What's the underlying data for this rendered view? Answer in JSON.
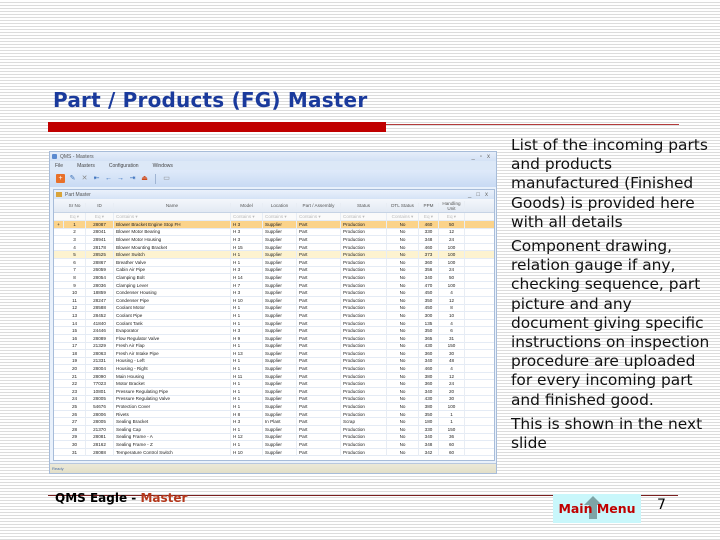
{
  "slide": {
    "title": "Part / Products (FG) Master",
    "bullets": [
      "List of the incoming parts and products manufactured (Finished Goods) is provided here with all details",
      "Component drawing, relation gauge if any, checking sequence, part picture and any document giving specific instructions on inspection procedure are uploaded for every incoming part and finished good.",
      "This is shown in the next slide"
    ],
    "footer": {
      "brand_prefix": "QMS Eagle - ",
      "brand_accent": "Master",
      "main_menu_label": "Main Menu",
      "page_number": "7"
    }
  },
  "app": {
    "title": "QMS - Masters",
    "window_controls": [
      "_",
      "▫",
      "x"
    ],
    "menu": [
      "File",
      "Masters",
      "Configuration",
      "Windows"
    ],
    "toolbar": [
      {
        "name": "add",
        "glyph": "+",
        "color": "#e8702a"
      },
      {
        "name": "edit",
        "glyph": "✎",
        "color": "#3a6fb5"
      },
      {
        "name": "delete",
        "glyph": "✕",
        "color": "#8a8a8a"
      },
      {
        "name": "first",
        "glyph": "⇤",
        "color": "#2f68b8"
      },
      {
        "name": "previous",
        "glyph": "←",
        "color": "#2f68b8"
      },
      {
        "name": "next",
        "glyph": "→",
        "color": "#2f68b8"
      },
      {
        "name": "last",
        "glyph": "⇥",
        "color": "#2f68b8"
      },
      {
        "name": "exit",
        "glyph": "⏏",
        "color": "#d04a1a"
      },
      {
        "name": "notes",
        "glyph": "▭",
        "color": "#8a8a8a"
      }
    ],
    "inner_window": {
      "title": "Part Master",
      "window_controls": [
        "_",
        "□",
        "x"
      ],
      "columns": [
        "Sr No",
        "ID",
        "Name",
        "Model",
        "Location",
        "Part / Assembly",
        "Status",
        "DTL Status",
        "PPM",
        "Handling Unit"
      ],
      "filter_placeholders": [
        "Eq",
        "Eq",
        "Contains",
        "Contains",
        "Contains",
        "Contains",
        "Contains",
        "Contains",
        "Eq",
        "Eq"
      ],
      "rows": [
        [
          "1",
          "28087",
          "Blower Bracket Engine Stop FH",
          "H 3",
          "Supplier",
          "Part",
          "Production",
          "No",
          "460",
          "50"
        ],
        [
          "2",
          "28041",
          "Blower Motor Bearing",
          "H 3",
          "Supplier",
          "Part",
          "Production",
          "No",
          "330",
          "12"
        ],
        [
          "3",
          "28941",
          "Blower Motor Housing",
          "H 3",
          "Supplier",
          "Part",
          "Production",
          "No",
          "348",
          "24"
        ],
        [
          "4",
          "28178",
          "Blower Mounting Bracket",
          "H 15",
          "Supplier",
          "Part",
          "Production",
          "No",
          "460",
          "100"
        ],
        [
          "5",
          "28525",
          "Blower Switch",
          "H 1",
          "Supplier",
          "Part",
          "Production",
          "No",
          "373",
          "100"
        ],
        [
          "6",
          "28867",
          "Breather Valve",
          "H 1",
          "Supplier",
          "Part",
          "Production",
          "No",
          "360",
          "100"
        ],
        [
          "7",
          "26059",
          "Cabin Air Pipe",
          "H 3",
          "Supplier",
          "Part",
          "Production",
          "No",
          "356",
          "24"
        ],
        [
          "8",
          "28054",
          "Clamping Bolt",
          "H 14",
          "Supplier",
          "Part",
          "Production",
          "No",
          "340",
          "50"
        ],
        [
          "9",
          "28036",
          "Clamping Lever",
          "H 7",
          "Supplier",
          "Part",
          "Production",
          "No",
          "470",
          "100"
        ],
        [
          "10",
          "18859",
          "Condenser Housing",
          "H 3",
          "Supplier",
          "Part",
          "Production",
          "No",
          "450",
          "4"
        ],
        [
          "11",
          "28247",
          "Condenser Pipe",
          "H 10",
          "Supplier",
          "Part",
          "Production",
          "No",
          "350",
          "12"
        ],
        [
          "12",
          "28588",
          "Coolant Motor",
          "H 1",
          "Supplier",
          "Part",
          "Production",
          "No",
          "450",
          "8"
        ],
        [
          "13",
          "28452",
          "Coolant Pipe",
          "H 1",
          "Supplier",
          "Part",
          "Production",
          "No",
          "300",
          "10"
        ],
        [
          "14",
          "41840",
          "Coolant Tank",
          "H 1",
          "Supplier",
          "Part",
          "Production",
          "No",
          "135",
          "4"
        ],
        [
          "15",
          "24446",
          "Evaporator",
          "H 3",
          "Supplier",
          "Part",
          "Production",
          "No",
          "350",
          "6"
        ],
        [
          "16",
          "28089",
          "Flow Regulator Valve",
          "H 9",
          "Supplier",
          "Part",
          "Production",
          "No",
          "365",
          "31"
        ],
        [
          "17",
          "21329",
          "Fresh Air Flap",
          "H 1",
          "Supplier",
          "Part",
          "Production",
          "No",
          "430",
          "150"
        ],
        [
          "18",
          "28063",
          "Fresh Air Intake Pipe",
          "H 13",
          "Supplier",
          "Part",
          "Production",
          "No",
          "360",
          "30"
        ],
        [
          "19",
          "21331",
          "Housing - Left",
          "H 1",
          "Supplier",
          "Part",
          "Production",
          "No",
          "340",
          "48"
        ],
        [
          "20",
          "28004",
          "Housing - Right",
          "H 1",
          "Supplier",
          "Part",
          "Production",
          "No",
          "460",
          "4"
        ],
        [
          "21",
          "28090",
          "Main Housing",
          "H 11",
          "Supplier",
          "Part",
          "Production",
          "No",
          "380",
          "12"
        ],
        [
          "22",
          "77023",
          "Motor Bracket",
          "H 1",
          "Supplier",
          "Part",
          "Production",
          "No",
          "360",
          "24"
        ],
        [
          "23",
          "10801",
          "Pressure Regulating Pipe",
          "H 1",
          "Supplier",
          "Part",
          "Production",
          "No",
          "340",
          "20"
        ],
        [
          "24",
          "28005",
          "Pressure Regulating Valve",
          "H 1",
          "Supplier",
          "Part",
          "Production",
          "No",
          "430",
          "30"
        ],
        [
          "25",
          "54676",
          "Protection Cover",
          "H 1",
          "Supplier",
          "Part",
          "Production",
          "No",
          "380",
          "100"
        ],
        [
          "26",
          "28006",
          "Rivets",
          "H 8",
          "Supplier",
          "Part",
          "Production",
          "No",
          "350",
          "1"
        ],
        [
          "27",
          "28005",
          "Sealing Bracket",
          "H 3",
          "In Plant",
          "Part",
          "Scrap",
          "No",
          "180",
          "1"
        ],
        [
          "28",
          "21370",
          "Sealing Cap",
          "H 1",
          "Supplier",
          "Part",
          "Production",
          "No",
          "330",
          "150"
        ],
        [
          "29",
          "28081",
          "Sealing Frame - A",
          "H 12",
          "Supplier",
          "Part",
          "Production",
          "No",
          "340",
          "36"
        ],
        [
          "30",
          "28162",
          "Sealing Frame - Z",
          "H 1",
          "Supplier",
          "Part",
          "Production",
          "No",
          "348",
          "60"
        ],
        [
          "31",
          "28088",
          "Temperature Control Switch",
          "H 10",
          "Supplier",
          "Part",
          "Production",
          "No",
          "342",
          "60"
        ]
      ],
      "selected_row": 0,
      "highlight_row": 4,
      "row_indicator": "+"
    },
    "status_bar_text": "Ready"
  }
}
